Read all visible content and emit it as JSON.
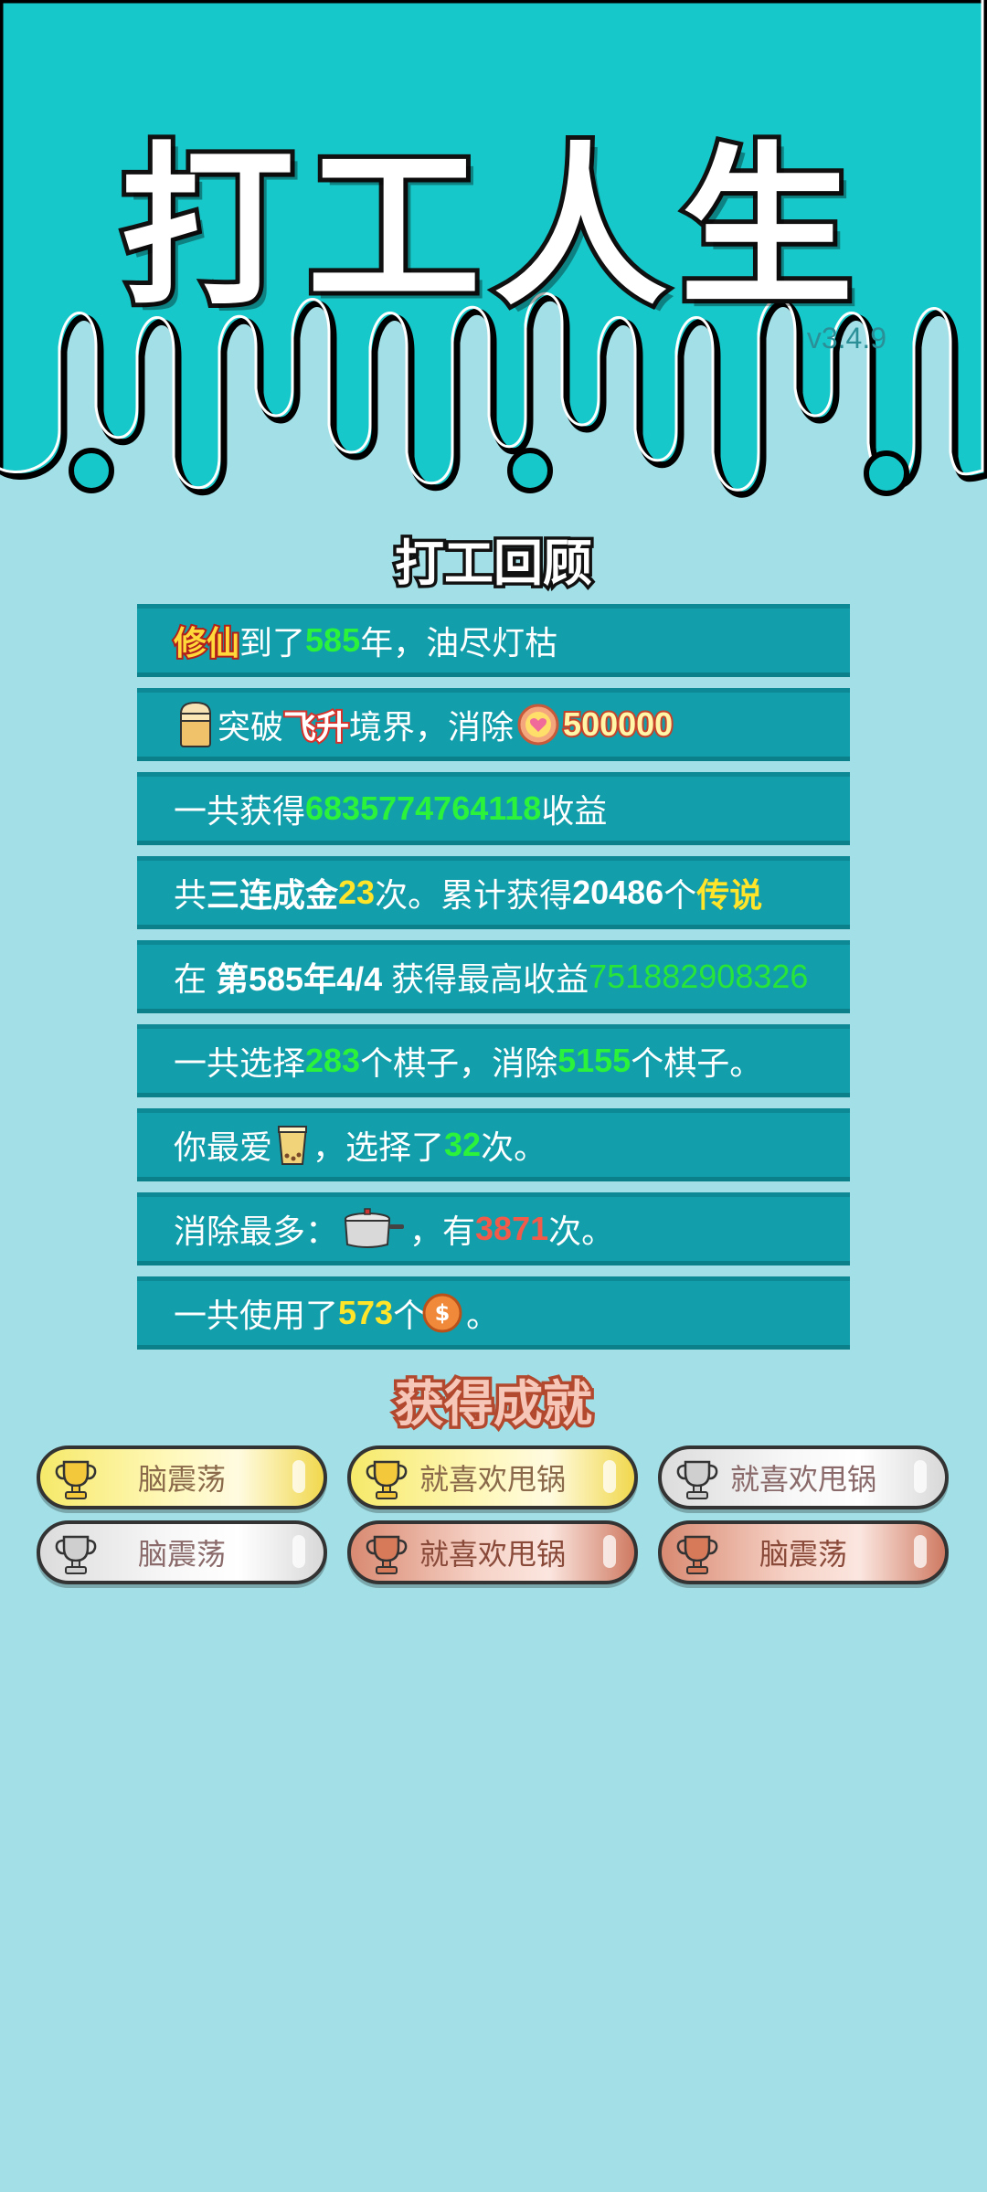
{
  "app": {
    "title": "打工人生",
    "version": "v3.4.9"
  },
  "colors": {
    "top_band": "#16c8c9",
    "background": "#a2dfe6",
    "row_bg": "#129eab",
    "green": "#2bf23a",
    "yellow": "#ffe52a"
  },
  "review": {
    "title": "打工回顾",
    "row1": {
      "realm": "修仙",
      "t1": "到了",
      "years": "585",
      "t2": "年，油尽灯枯"
    },
    "row2": {
      "t1": "突破",
      "stage": "飞升",
      "t2": "境界，消除",
      "amount": "500000"
    },
    "row3": {
      "t1": "一共获得",
      "amount": "6835774764118",
      "t2": "收益"
    },
    "row4": {
      "t1": "共",
      "combo": "三连成金",
      "count": "23",
      "t2": "次。累计获得",
      "total": "20486",
      "t3": "个",
      "tier": "传说"
    },
    "row5": {
      "t1": "在 ",
      "period": "第585年4/4",
      "t2": " 获得最高收益",
      "amount": "751882908326"
    },
    "row6": {
      "t1": "一共选择",
      "chosen": "283",
      "t2": "个棋子，消除",
      "removed": "5155",
      "t3": "个棋子。"
    },
    "row7": {
      "t1": "你最爱",
      "t2": "，选择了",
      "count": "32",
      "t3": "次。"
    },
    "row8": {
      "t1": "消除最多：",
      "t2": "，有",
      "count": "3871",
      "t3": "次。"
    },
    "row9": {
      "t1": "一共使用了",
      "count": "573",
      "t2": "个",
      "t3": "。"
    }
  },
  "achievements": {
    "title": "获得成就",
    "badges": [
      {
        "label": "脑震荡",
        "tier": "gold"
      },
      {
        "label": "就喜欢甩锅",
        "tier": "gold"
      },
      {
        "label": "就喜欢甩锅",
        "tier": "silver"
      },
      {
        "label": "脑震荡",
        "tier": "silver"
      },
      {
        "label": "就喜欢甩锅",
        "tier": "bronze"
      },
      {
        "label": "脑震荡",
        "tier": "bronze"
      }
    ]
  }
}
